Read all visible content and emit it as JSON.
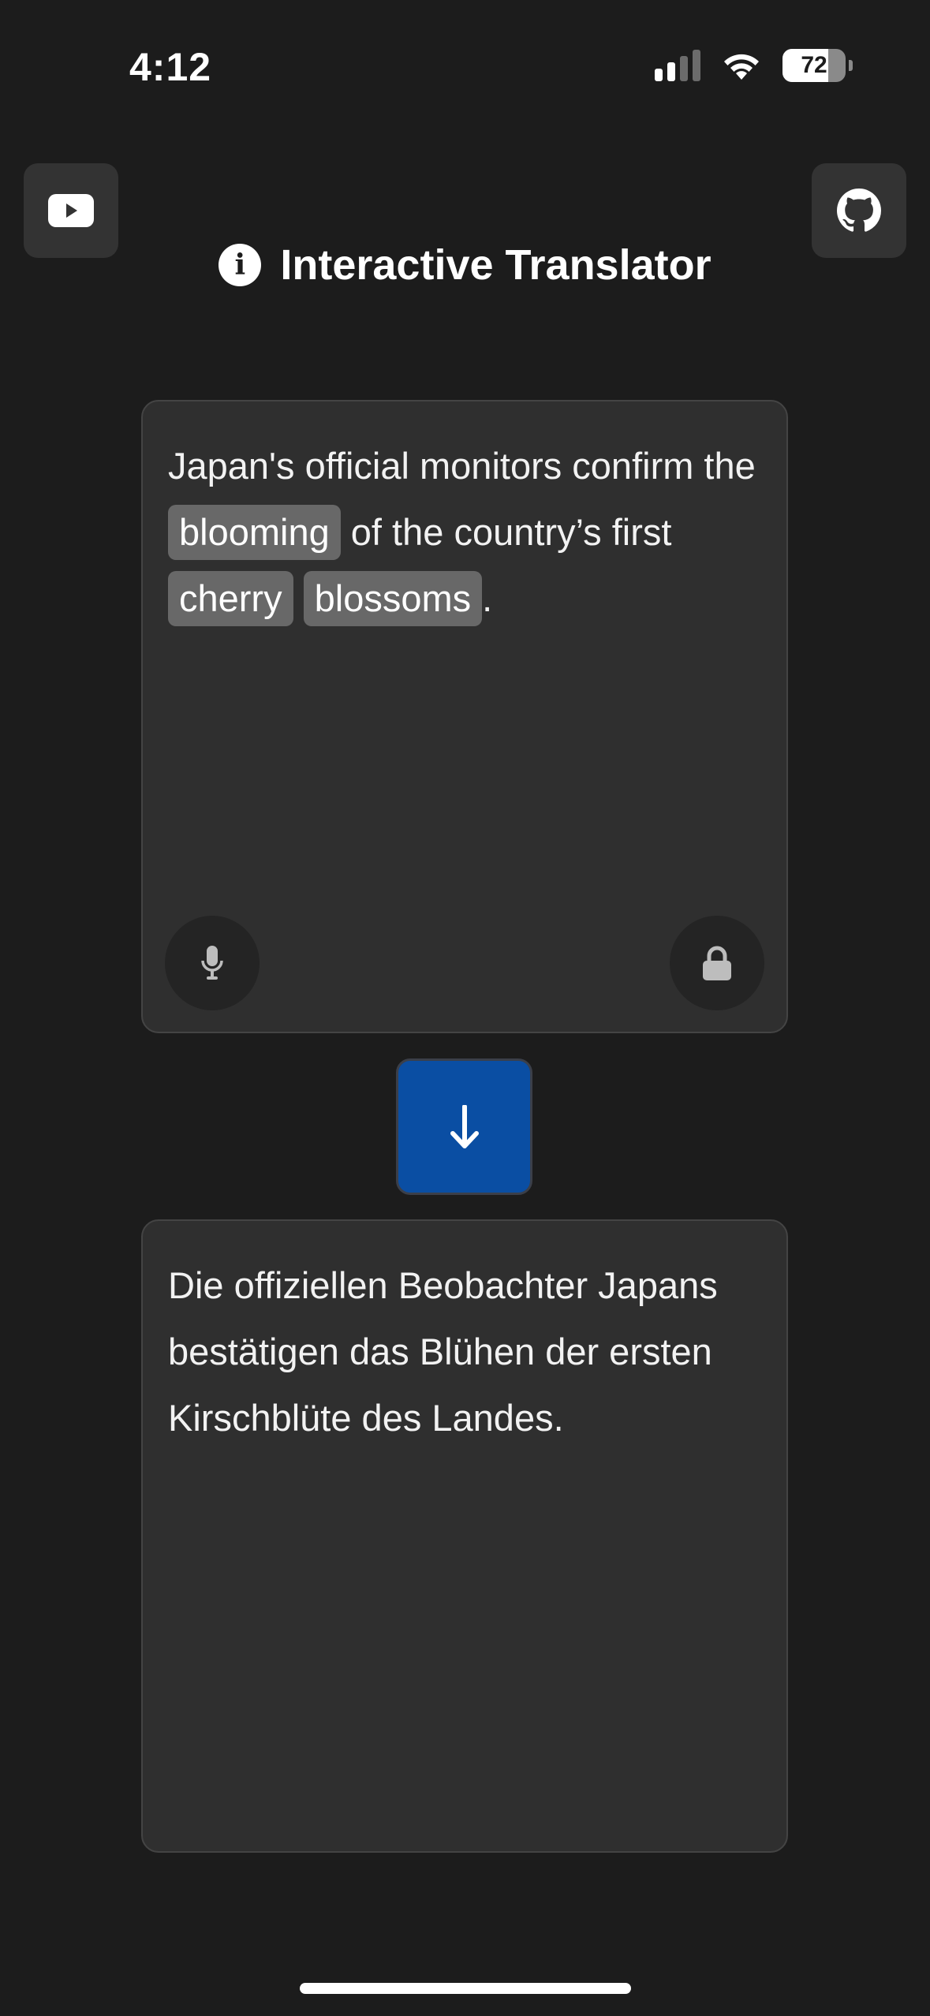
{
  "status_bar": {
    "time": "4:12",
    "battery": "72"
  },
  "header": {
    "title": "Interactive Translator",
    "left_icon": "youtube-icon",
    "right_icon": "github-icon",
    "info_icon": "info-icon"
  },
  "source": {
    "segments": [
      {
        "text": "Japan's official monitors confirm the ",
        "highlight": false
      },
      {
        "text": "blooming",
        "highlight": true
      },
      {
        "text": " of the country’s first ",
        "highlight": false
      },
      {
        "text": "cherry",
        "highlight": true
      },
      {
        "text": " ",
        "highlight": false
      },
      {
        "text": "blossoms",
        "highlight": true
      },
      {
        "text": ".",
        "highlight": false
      }
    ],
    "mic_icon": "microphone-icon",
    "lock_icon": "lock-icon"
  },
  "translate_button": {
    "icon": "arrow-down-icon",
    "color": "#0a4ea3"
  },
  "target": {
    "text": "Die offiziellen Beobachter Japans bestätigen das Blühen der ersten Kirschblüte des Landes."
  },
  "colors": {
    "background": "#1c1c1c",
    "panel": "#2f2f2f",
    "chip": "#686868",
    "accent": "#0a4ea3"
  }
}
